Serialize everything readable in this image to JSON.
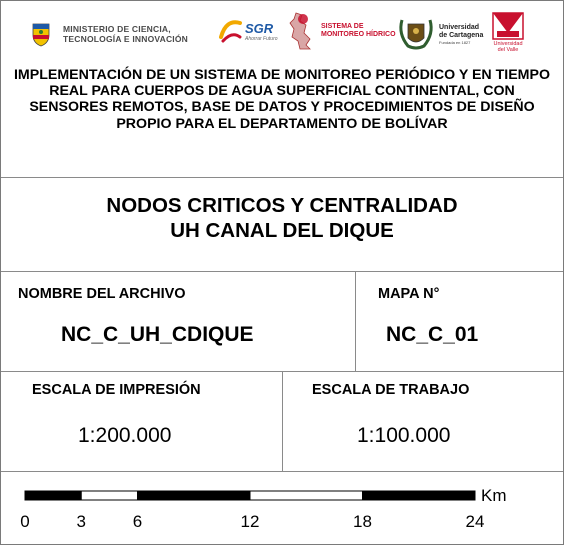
{
  "logos": {
    "ministerio": "MINISTERIO DE CIENCIA,\nTECNOLOGÍA E INNOVACIÓN",
    "sgr": "SGR",
    "sgr_sub": "Ahorrar Futuro",
    "smh": "SISTEMA DE\nMONITOREO HÍDRICO",
    "udc": "Universidad\nde Cartagena",
    "udc_sub": "Fundada en 1827",
    "uv": "Universidad\ndel Valle"
  },
  "project_title": "IMPLEMENTACIÓN DE UN SISTEMA DE MONITOREO PERIÓDICO Y EN TIEMPO REAL PARA CUERPOS DE AGUA SUPERFICIAL CONTINENTAL, CON SENSORES REMOTOS, BASE DE DATOS Y PROCEDIMIENTOS DE DISEÑO PROPIO PARA EL DEPARTAMENTO DE BOLÍVAR",
  "map_title": {
    "line1": "NODOS CRITICOS Y CENTRALIDAD",
    "line2": "UH CANAL DEL DIQUE"
  },
  "file": {
    "label": "NOMBRE DEL ARCHIVO",
    "value": "NC_C_UH_CDIQUE"
  },
  "map_no": {
    "label": "MAPA N°",
    "value": "NC_C_01"
  },
  "print_scale": {
    "label": "ESCALA DE IMPRESIÓN",
    "value": "1:200.000"
  },
  "work_scale": {
    "label": "ESCALA DE TRABAJO",
    "value": "1:100.000"
  },
  "scalebar": {
    "unit": "Km",
    "ticks": [
      0,
      3,
      6,
      12,
      18,
      24
    ],
    "max": 24,
    "colors": {
      "dark": "#000000",
      "light": "#ffffff"
    }
  },
  "colors": {
    "red": "#c8102e",
    "blue": "#1f5aa6",
    "gray": "#4a4a4a"
  }
}
